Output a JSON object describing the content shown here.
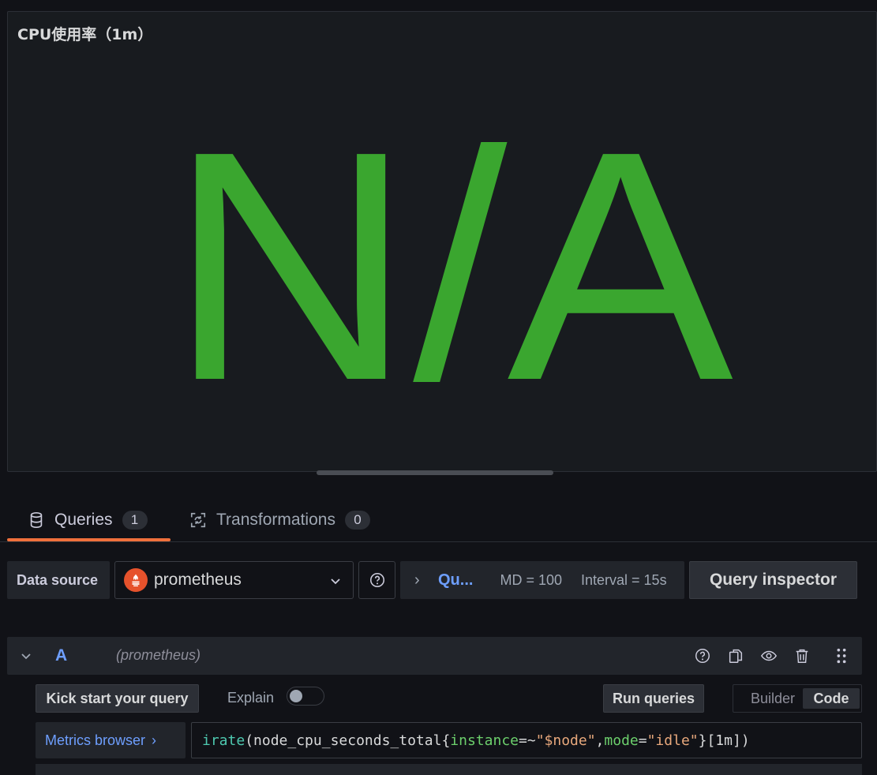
{
  "panel": {
    "title": "CPU使用率（1m）",
    "value_text": "N/A",
    "value_color": "#3aa62f"
  },
  "tabs": [
    {
      "label": "Queries",
      "count": "1",
      "icon": "database-icon",
      "active": true
    },
    {
      "label": "Transformations",
      "count": "0",
      "icon": "transform-icon",
      "active": false
    }
  ],
  "datasource": {
    "label": "Data source",
    "selected": "prometheus",
    "logo": "prometheus-logo",
    "brand_color": "#e6522c"
  },
  "query_options": {
    "collapsed_label": "Qu...",
    "max_data_points": "MD = 100",
    "interval": "Interval = 15s"
  },
  "query_inspector_label": "Query inspector",
  "query": {
    "ref_id": "A",
    "datasource_hint": "(prometheus)",
    "kick_start_label": "Kick start your query",
    "explain_label": "Explain",
    "explain_enabled": false,
    "run_label": "Run queries",
    "modes": [
      "Builder",
      "Code"
    ],
    "active_mode": "Code",
    "metrics_browser_label": "Metrics browser",
    "expression": {
      "fn": "irate",
      "open": "(",
      "metric": "node_cpu_seconds_total",
      "brace_open": "{",
      "label1": "instance",
      "op1": "=~",
      "val1": "\"$node\"",
      "comma": ",",
      "label2": "mode",
      "op2": "=",
      "val2": "\"idle\"",
      "brace_close": "}",
      "range": "[1m]",
      "close": ")"
    }
  },
  "colors": {
    "accent_blue": "#6e9fff",
    "tab_underline": "#f0703c",
    "background": "#111217",
    "panel_bg": "#181b1f"
  }
}
